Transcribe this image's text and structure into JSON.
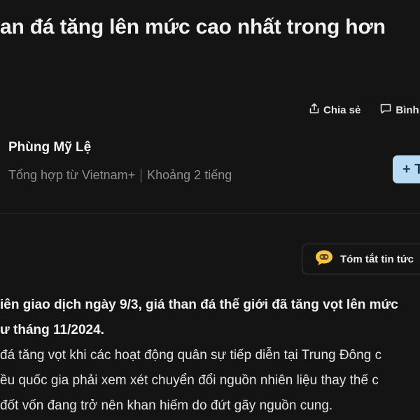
{
  "article": {
    "title": "an đá tăng lên mức cao nhất trong hơn",
    "author": "Phùng Mỹ Lệ",
    "source": "Tổng hợp từ Vietnam+",
    "time": "Khoảng 2 tiếng"
  },
  "actions": {
    "share_label": "Chia sẻ",
    "comment_label": "Bình"
  },
  "follow_button": {
    "label": "+ T"
  },
  "summary_button": {
    "label": "Tóm tắt tin tức"
  },
  "content": {
    "lead_lines": [
      "iên giao dịch ngày 9/3, giá than đá thế giới đã tăng vọt lên mức",
      "ư tháng 11/2024."
    ],
    "paragraph_lines": [
      "đá tăng vọt khi các hoạt động quân sự tiếp diễn tại Trung Đông c",
      "ều quốc gia phải xem xét chuyển đổi nguồn nhiên liệu thay thế c",
      " đốt vốn đang trở nên khan hiếm do đứt gãy nguồn cung."
    ]
  },
  "colors": {
    "background": "#141414",
    "follow_button_bg": "#b9dcf4",
    "robot_icon": "#f4c542"
  }
}
